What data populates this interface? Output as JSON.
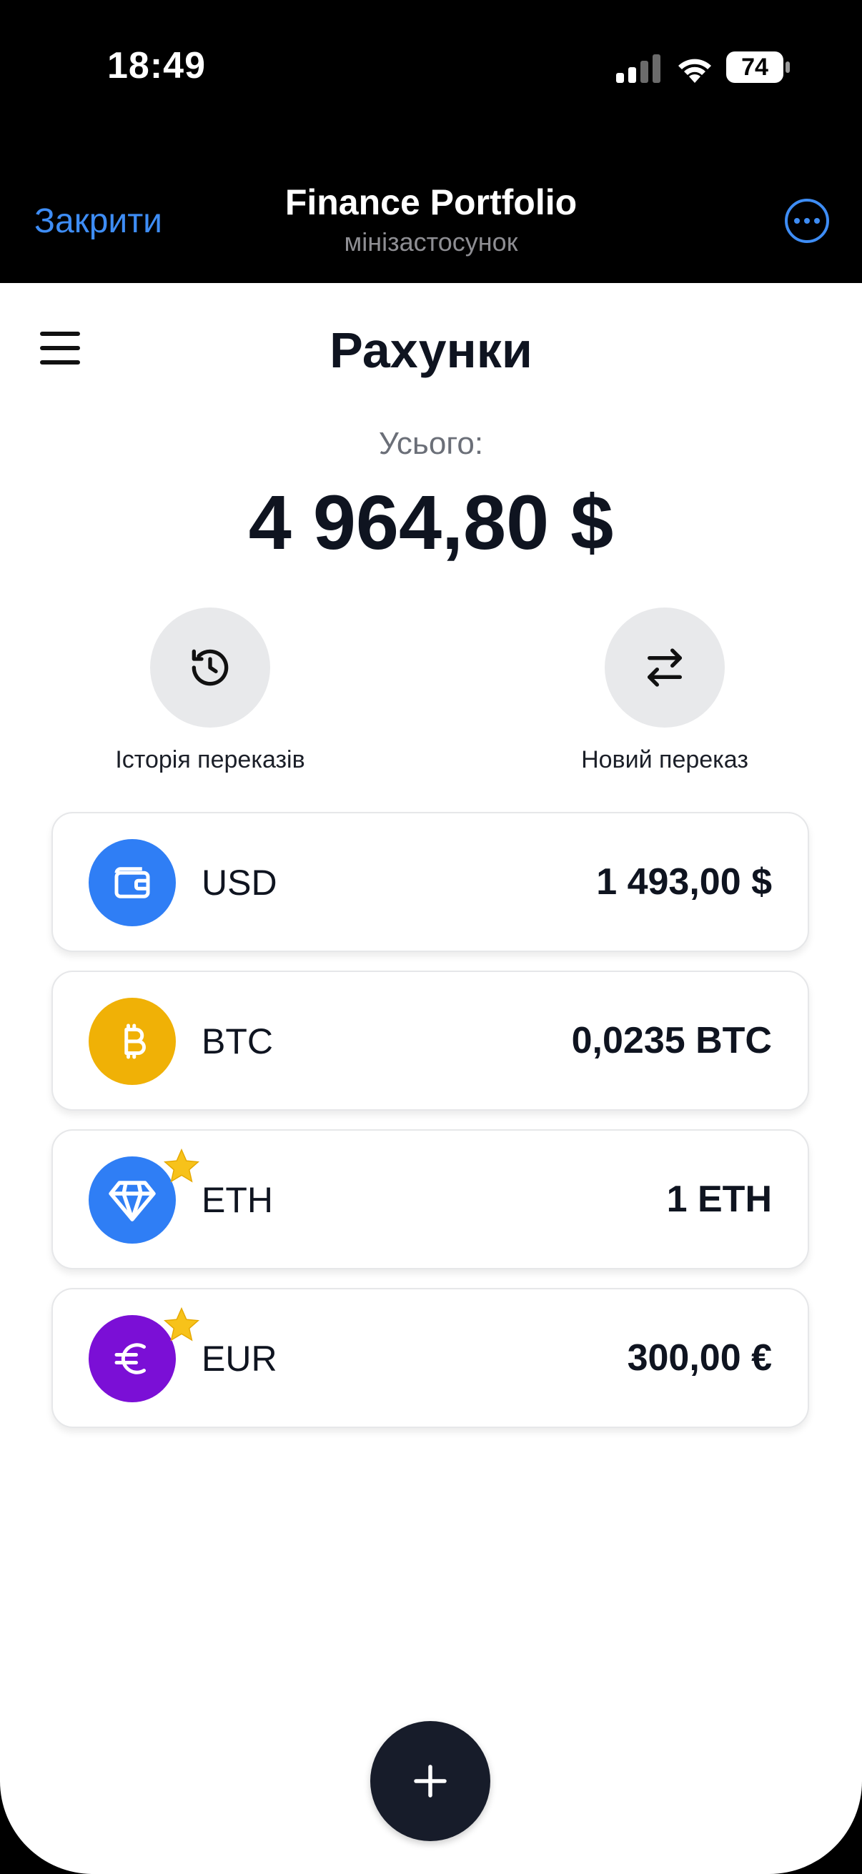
{
  "status_bar": {
    "time": "18:49",
    "battery": "74"
  },
  "header": {
    "close_label": "Закрити",
    "title": "Finance Portfolio",
    "subtitle": "мінізастосунок"
  },
  "page": {
    "title": "Рахунки",
    "total_label": "Усього:",
    "total_value": "4 964,80 $"
  },
  "actions": [
    {
      "label": "Історія переказів",
      "icon": "history-icon"
    },
    {
      "label": "Новий переказ",
      "icon": "transfer-arrows-icon"
    }
  ],
  "accounts": [
    {
      "code": "USD",
      "amount": "1 493,00 $",
      "icon": "wallet-icon",
      "color": "#2f7ef5",
      "starred": false
    },
    {
      "code": "BTC",
      "amount": "0,0235 BTC",
      "icon": "bitcoin-icon",
      "color": "#f0b106",
      "starred": false
    },
    {
      "code": "ETH",
      "amount": "1 ETH",
      "icon": "diamond-icon",
      "color": "#2f7ef5",
      "starred": true
    },
    {
      "code": "EUR",
      "amount": "300,00 €",
      "icon": "euro-icon",
      "color": "#7b0fd6",
      "starred": true
    }
  ],
  "colors": {
    "accent": "#3e8df5",
    "fab": "#171c2a",
    "star": "#f7c21a"
  }
}
